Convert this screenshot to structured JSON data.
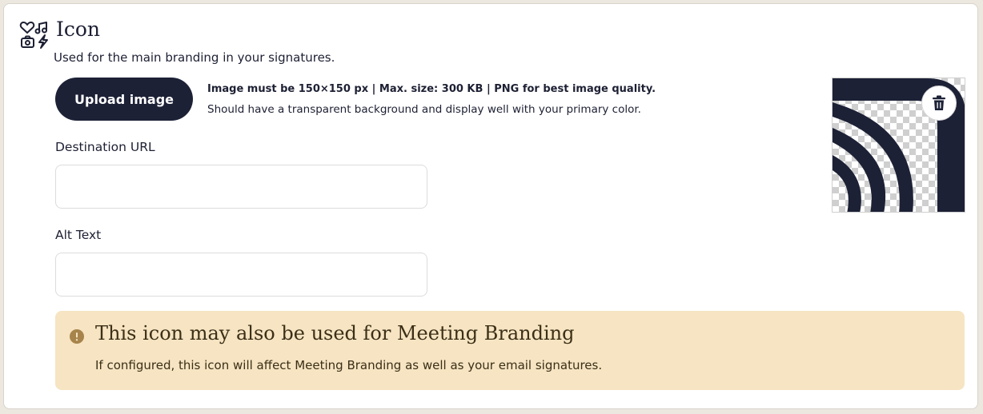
{
  "section": {
    "icon": "icon-category-icon",
    "title": "Icon",
    "subtitle": "Used for the main branding in your signatures."
  },
  "upload": {
    "button_label": "Upload image",
    "requirements_main": "Image must be 150×150 px | Max. size: 300 KB | PNG for best image quality.",
    "requirements_sub": "Should have a transparent background and display well with your primary color."
  },
  "fields": {
    "destination_url": {
      "label": "Destination URL",
      "value": "",
      "placeholder": ""
    },
    "alt_text": {
      "label": "Alt Text",
      "value": "",
      "placeholder": ""
    }
  },
  "preview": {
    "delete_icon": "trash-icon"
  },
  "alert": {
    "icon": "exclamation-circle-icon",
    "title": "This icon may also be used for Meeting Branding",
    "body": "If configured, this icon will affect Meeting Branding as well as your email signatures."
  },
  "colors": {
    "primary": "#1c2136",
    "alert_background": "#f6e4c2",
    "alert_icon": "#a7844b"
  }
}
